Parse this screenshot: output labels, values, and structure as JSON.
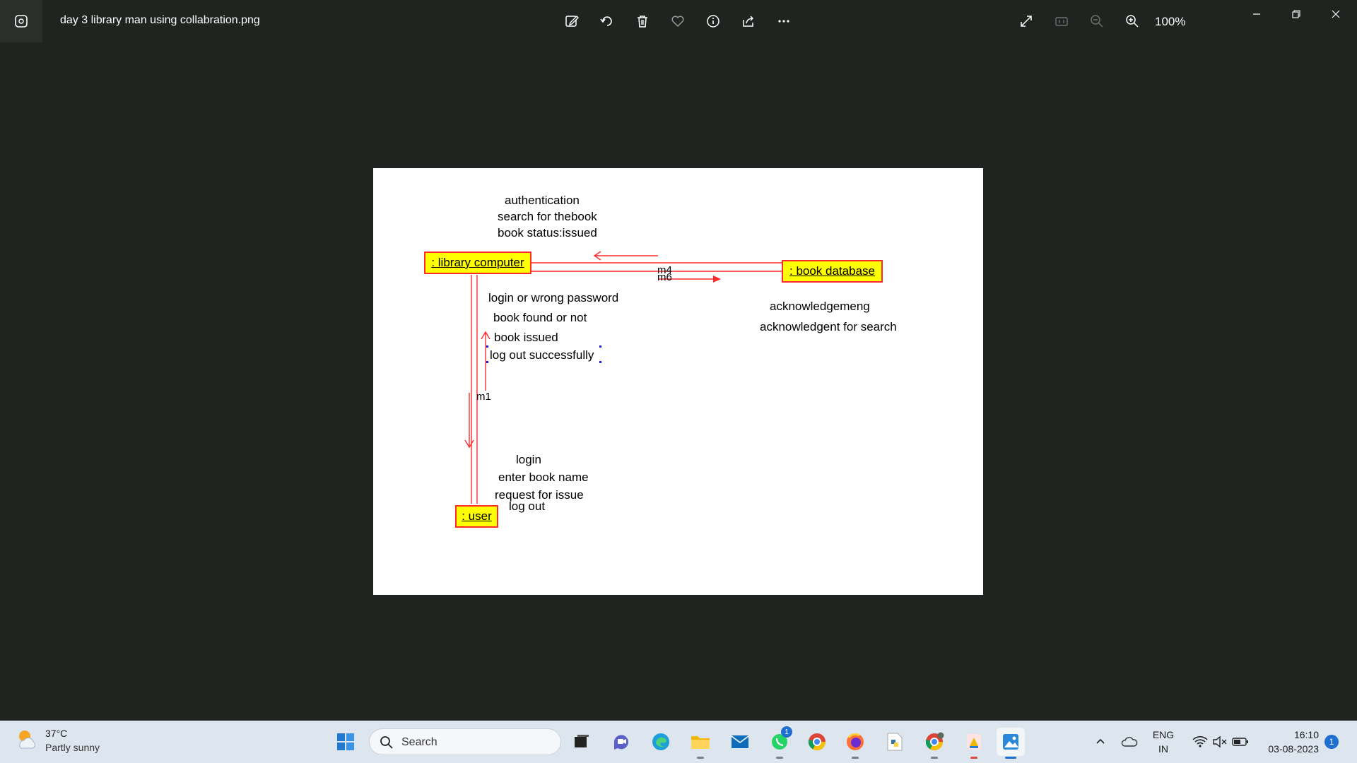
{
  "window": {
    "title": "day 3 library man using collabration.png",
    "zoom": "100%"
  },
  "toolbar": {
    "icons": [
      "edit-icon",
      "rotate-icon",
      "delete-icon",
      "favorite-icon",
      "info-icon",
      "share-icon",
      "more-icon"
    ],
    "right_icons": [
      "fullscreen-icon",
      "actual-size-icon",
      "zoom-out-icon",
      "zoom-in-icon"
    ]
  },
  "diagram": {
    "objects": {
      "library_computer": ": library computer",
      "book_database": ": book database",
      "user": ": user"
    },
    "top_messages": [
      "authentication",
      "search for thebook",
      "book status:issued"
    ],
    "middle_messages": [
      "login or wrong password",
      "book found or not",
      "book issued",
      "log out successfully"
    ],
    "right_messages": [
      "acknowledgemeng",
      "acknowledgent for search"
    ],
    "bottom_messages": [
      "login",
      "enter book name",
      "request for issue",
      "log out"
    ],
    "link_labels": {
      "m4": "m4",
      "m6": "m6",
      "m1": "m1"
    },
    "line_color": "#ff2a2a",
    "box_fill": "#ffff00"
  },
  "taskbar": {
    "weather_temp": "37°C",
    "weather_desc": "Partly sunny",
    "search_label": "Search",
    "whatsapp_badge": "1",
    "lang_line1": "ENG",
    "lang_line2": "IN",
    "time": "16:10",
    "date": "03-08-2023",
    "notifications": "1"
  }
}
